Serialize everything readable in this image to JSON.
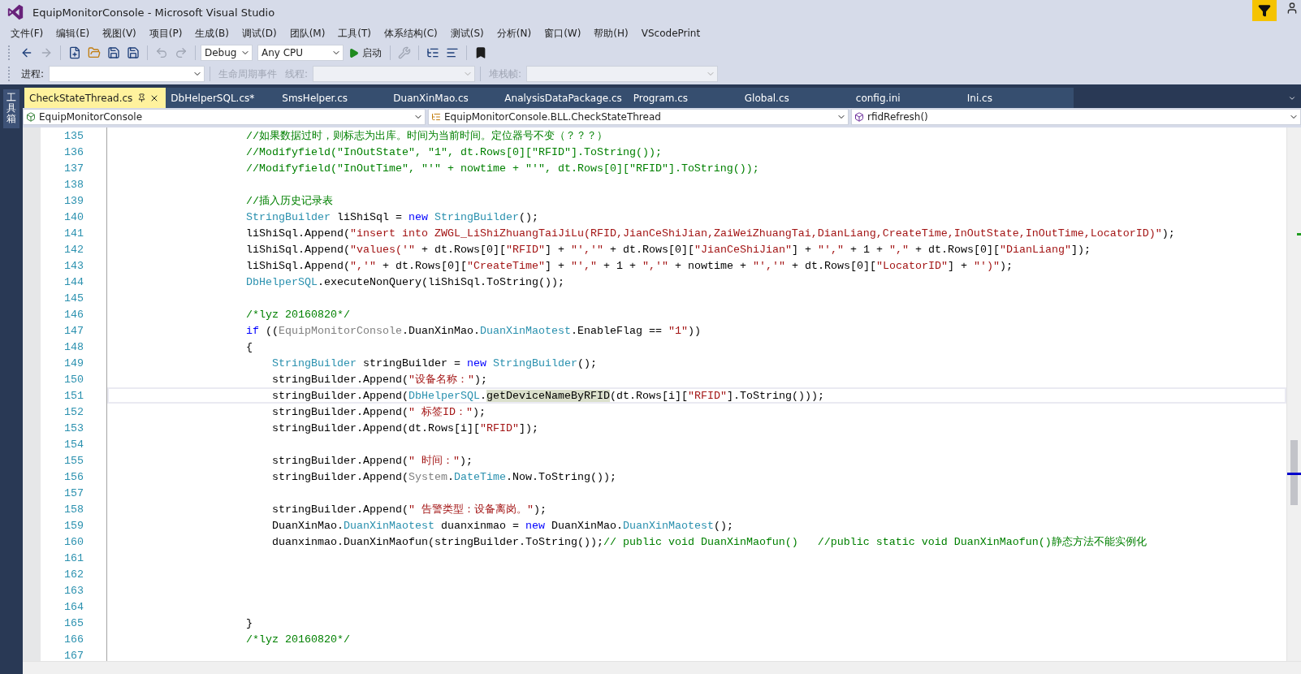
{
  "window": {
    "title": "EquipMonitorConsole - Microsoft Visual Studio"
  },
  "menu": [
    "文件(F)",
    "编辑(E)",
    "视图(V)",
    "项目(P)",
    "生成(B)",
    "调试(D)",
    "团队(M)",
    "工具(T)",
    "体系结构(C)",
    "测试(S)",
    "分析(N)",
    "窗口(W)",
    "帮助(H)",
    "VScodePrint"
  ],
  "toolbar": {
    "configuration": "Debug",
    "platform": "Any CPU",
    "start_label": "启动"
  },
  "debug_toolbar": {
    "process_label": "进程:",
    "lifecycle": {
      "label": "生命周期事件",
      "disabled": true
    },
    "thread_label": "线程:",
    "stack_frame_label": "堆栈帧:"
  },
  "side_panel": {
    "label": "工具箱"
  },
  "tabs": [
    {
      "label": "CheckStateThread.cs",
      "selected": true
    },
    {
      "label": "DbHelperSQL.cs*",
      "selected": false
    },
    {
      "label": "SmsHelper.cs",
      "selected": false
    },
    {
      "label": "DuanXinMao.cs",
      "selected": false
    },
    {
      "label": "AnalysisDataPackage.cs",
      "selected": false
    },
    {
      "label": "Program.cs",
      "selected": false
    },
    {
      "label": "Global.cs",
      "selected": false
    },
    {
      "label": "config.ini",
      "selected": false
    },
    {
      "label": "Ini.cs",
      "selected": false
    }
  ],
  "navigation": {
    "project": "EquipMonitorConsole",
    "type": "EquipMonitorConsole.BLL.CheckStateThread",
    "member": "rfidRefresh()"
  },
  "lines": [
    {
      "number": "135",
      "current": false,
      "kind": "outer",
      "tokens": [
        {
          "kind": "comment",
          "text": "//如果数据过时，则标志为出库。时间为当前时间。定位器号不变（？？？）"
        }
      ]
    },
    {
      "number": "136",
      "current": false,
      "kind": "outer",
      "tokens": [
        {
          "kind": "comment",
          "text": "//Modifyfield(\"InOutState\", \"1\", dt.Rows[0][\"RFID\"].ToString());"
        }
      ]
    },
    {
      "number": "137",
      "current": false,
      "kind": "outer",
      "tokens": [
        {
          "kind": "comment",
          "text": "//Modifyfield(\"InOutTime\", \"'\" + nowtime + \"'\", dt.Rows[0][\"RFID\"].ToString());"
        }
      ]
    },
    {
      "number": "138",
      "current": false,
      "kind": "blank"
    },
    {
      "number": "139",
      "current": false,
      "kind": "outer",
      "tokens": [
        {
          "kind": "comment",
          "text": "//插入历史记录表"
        }
      ]
    },
    {
      "number": "140",
      "current": false,
      "kind": "outer",
      "tokens": [
        {
          "kind": "type",
          "text": "StringBuilder"
        },
        {
          "kind": "plain",
          "text": " liShiSql = "
        },
        {
          "kind": "keyword",
          "text": "new "
        },
        {
          "kind": "type",
          "text": "StringBuilder"
        },
        {
          "kind": "plain",
          "text": "();"
        }
      ]
    },
    {
      "number": "141",
      "current": false,
      "kind": "outer",
      "tokens": [
        {
          "kind": "plain",
          "text": "liShiSql.Append("
        },
        {
          "kind": "string",
          "text": "\"insert into ZWGL_LiShiZhuangTaiJiLu(RFID,JianCeShiJian,ZaiWeiZhuangTai,DianLiang,CreateTime,InOutState,InOutTime,LocatorID)\""
        },
        {
          "kind": "plain",
          "text": ");"
        }
      ]
    },
    {
      "number": "142",
      "current": false,
      "kind": "outer",
      "tokens": [
        {
          "kind": "plain",
          "text": "liShiSql.Append("
        },
        {
          "kind": "string",
          "text": "\"values('\""
        },
        {
          "kind": "plain",
          "text": " + dt.Rows[0]["
        },
        {
          "kind": "string",
          "text": "\"RFID\""
        },
        {
          "kind": "plain",
          "text": "] + "
        },
        {
          "kind": "string",
          "text": "\"','\""
        },
        {
          "kind": "plain",
          "text": " + dt.Rows[0]["
        },
        {
          "kind": "string",
          "text": "\"JianCeShiJian\""
        },
        {
          "kind": "plain",
          "text": "] + "
        },
        {
          "kind": "string",
          "text": "\"',\""
        },
        {
          "kind": "plain",
          "text": " + 1 + "
        },
        {
          "kind": "string",
          "text": "\",\""
        },
        {
          "kind": "plain",
          "text": " + dt.Rows[0]["
        },
        {
          "kind": "string",
          "text": "\"DianLiang\""
        },
        {
          "kind": "plain",
          "text": "]);"
        }
      ]
    },
    {
      "number": "143",
      "current": false,
      "kind": "outer",
      "tokens": [
        {
          "kind": "plain",
          "text": "liShiSql.Append("
        },
        {
          "kind": "string",
          "text": "\",'\""
        },
        {
          "kind": "plain",
          "text": " + dt.Rows[0]["
        },
        {
          "kind": "string",
          "text": "\"CreateTime\""
        },
        {
          "kind": "plain",
          "text": "] + "
        },
        {
          "kind": "string",
          "text": "\"',\""
        },
        {
          "kind": "plain",
          "text": " + 1 + "
        },
        {
          "kind": "string",
          "text": "\",'\""
        },
        {
          "kind": "plain",
          "text": " + nowtime + "
        },
        {
          "kind": "string",
          "text": "\"','\""
        },
        {
          "kind": "plain",
          "text": " + dt.Rows[0]["
        },
        {
          "kind": "string",
          "text": "\"LocatorID\""
        },
        {
          "kind": "plain",
          "text": "] + "
        },
        {
          "kind": "string",
          "text": "\"')\""
        },
        {
          "kind": "plain",
          "text": ");"
        }
      ]
    },
    {
      "number": "144",
      "current": false,
      "kind": "outer",
      "tokens": [
        {
          "kind": "type",
          "text": "DbHelperSQL"
        },
        {
          "kind": "plain",
          "text": ".executeNonQuery(liShiSql.ToString());"
        }
      ]
    },
    {
      "number": "145",
      "current": false,
      "kind": "blank"
    },
    {
      "number": "146",
      "current": false,
      "kind": "outer",
      "tokens": [
        {
          "kind": "comment",
          "text": "/*lyz 20160820*/"
        }
      ]
    },
    {
      "number": "147",
      "current": false,
      "kind": "outer",
      "tokens": [
        {
          "kind": "keyword",
          "text": "if"
        },
        {
          "kind": "plain",
          "text": " (("
        },
        {
          "kind": "namespace",
          "text": "EquipMonitorConsole"
        },
        {
          "kind": "plain",
          "text": ".DuanXinMao."
        },
        {
          "kind": "type",
          "text": "DuanXinMaotest"
        },
        {
          "kind": "plain",
          "text": ".EnableFlag == "
        },
        {
          "kind": "string",
          "text": "\"1\""
        },
        {
          "kind": "plain",
          "text": "))"
        }
      ]
    },
    {
      "number": "148",
      "current": false,
      "kind": "outer",
      "tokens": [
        {
          "kind": "plain",
          "text": "{"
        }
      ]
    },
    {
      "number": "149",
      "current": false,
      "kind": "inner",
      "tokens": [
        {
          "kind": "type",
          "text": "StringBuilder"
        },
        {
          "kind": "plain",
          "text": " stringBuilder = "
        },
        {
          "kind": "keyword",
          "text": "new "
        },
        {
          "kind": "type",
          "text": "StringBuilder"
        },
        {
          "kind": "plain",
          "text": "();"
        }
      ]
    },
    {
      "number": "150",
      "current": false,
      "kind": "inner",
      "tokens": [
        {
          "kind": "plain",
          "text": "stringBuilder.Append("
        },
        {
          "kind": "string",
          "text": "\"设备名称：\""
        },
        {
          "kind": "plain",
          "text": ");"
        }
      ]
    },
    {
      "number": "151",
      "current": true,
      "kind": "inner",
      "tokens": [
        {
          "kind": "plain",
          "text": "stringBuilder.Append("
        },
        {
          "kind": "type",
          "text": "DbHelperSQL"
        },
        {
          "kind": "plain",
          "text": "."
        },
        {
          "kind": "reference",
          "text": "getDeviceNameByRFID"
        },
        {
          "kind": "plain",
          "text": "(dt.Rows[i]["
        },
        {
          "kind": "string",
          "text": "\"RFID\""
        },
        {
          "kind": "plain",
          "text": "].ToString()));"
        }
      ]
    },
    {
      "number": "152",
      "current": false,
      "kind": "inner",
      "tokens": [
        {
          "kind": "plain",
          "text": "stringBuilder.Append("
        },
        {
          "kind": "string",
          "text": "\" 标签ID：\""
        },
        {
          "kind": "plain",
          "text": ");"
        }
      ]
    },
    {
      "number": "153",
      "current": false,
      "kind": "inner",
      "tokens": [
        {
          "kind": "plain",
          "text": "stringBuilder.Append(dt.Rows[i]["
        },
        {
          "kind": "string",
          "text": "\"RFID\""
        },
        {
          "kind": "plain",
          "text": "]);"
        }
      ]
    },
    {
      "number": "154",
      "current": false,
      "kind": "blank"
    },
    {
      "number": "155",
      "current": false,
      "kind": "inner",
      "tokens": [
        {
          "kind": "plain",
          "text": "stringBuilder.Append("
        },
        {
          "kind": "string",
          "text": "\" 时间：\""
        },
        {
          "kind": "plain",
          "text": ");"
        }
      ]
    },
    {
      "number": "156",
      "current": false,
      "kind": "inner",
      "tokens": [
        {
          "kind": "plain",
          "text": "stringBuilder.Append("
        },
        {
          "kind": "namespace",
          "text": "System"
        },
        {
          "kind": "plain",
          "text": "."
        },
        {
          "kind": "type",
          "text": "DateTime"
        },
        {
          "kind": "plain",
          "text": ".Now.ToString());"
        }
      ]
    },
    {
      "number": "157",
      "current": false,
      "kind": "blank"
    },
    {
      "number": "158",
      "current": false,
      "kind": "inner",
      "tokens": [
        {
          "kind": "plain",
          "text": "stringBuilder.Append("
        },
        {
          "kind": "string",
          "text": "\" 告警类型：设备离岗。\""
        },
        {
          "kind": "plain",
          "text": ");"
        }
      ]
    },
    {
      "number": "159",
      "current": false,
      "kind": "inner",
      "tokens": [
        {
          "kind": "plain",
          "text": "DuanXinMao."
        },
        {
          "kind": "type",
          "text": "DuanXinMaotest"
        },
        {
          "kind": "plain",
          "text": " duanxinmao = "
        },
        {
          "kind": "keyword",
          "text": "new "
        },
        {
          "kind": "plain",
          "text": "DuanXinMao."
        },
        {
          "kind": "type",
          "text": "DuanXinMaotest"
        },
        {
          "kind": "plain",
          "text": "();"
        }
      ]
    },
    {
      "number": "160",
      "current": false,
      "kind": "inner",
      "tokens": [
        {
          "kind": "plain",
          "text": "duanxinmao.DuanXinMaofun(stringBuilder.ToString());"
        },
        {
          "kind": "comment",
          "text": "// public void DuanXinMaofun()   //public static void DuanXinMaofun()静态方法不能实例化"
        }
      ]
    },
    {
      "number": "161",
      "current": false,
      "kind": "blank"
    },
    {
      "number": "162",
      "current": false,
      "kind": "blank"
    },
    {
      "number": "163",
      "current": false,
      "kind": "blank"
    },
    {
      "number": "164",
      "current": false,
      "kind": "blank"
    },
    {
      "number": "165",
      "current": false,
      "kind": "outer",
      "tokens": [
        {
          "kind": "plain",
          "text": "}"
        }
      ]
    },
    {
      "number": "166",
      "current": false,
      "kind": "outer",
      "tokens": [
        {
          "kind": "comment",
          "text": "/*lyz 20160820*/"
        }
      ]
    },
    {
      "number": "167",
      "current": false,
      "kind": "blank"
    }
  ]
}
